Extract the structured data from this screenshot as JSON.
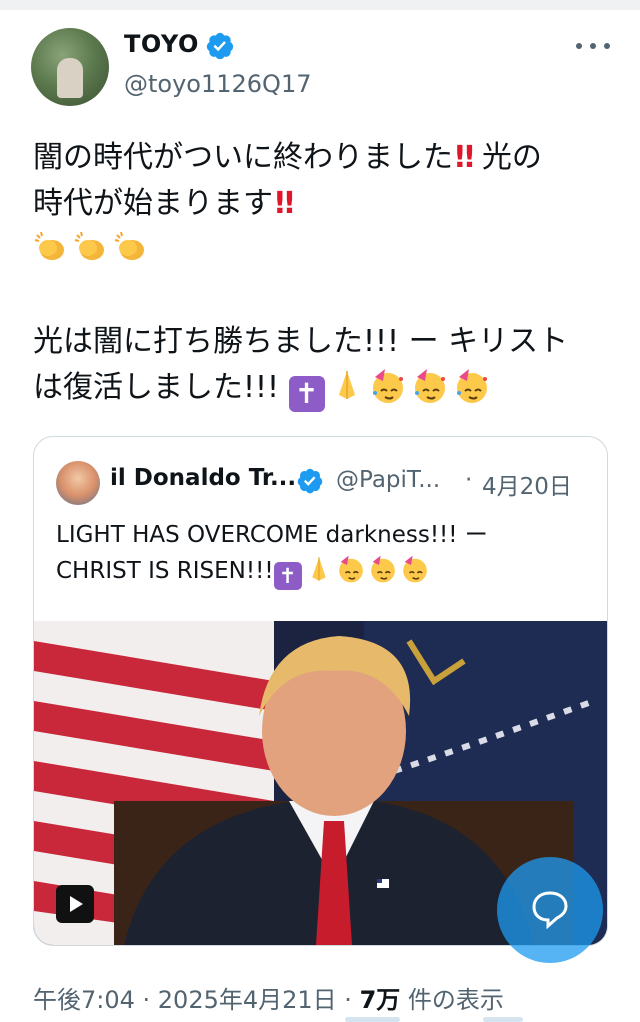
{
  "author": {
    "name": "TOYO",
    "handle": "@toyo1126Q17",
    "verified_icon": "verified-badge-icon",
    "more_icon": "more-icon"
  },
  "tweet": {
    "line1_a": "闇の時代がついに終わりました",
    "line1_b": "光の",
    "line2": "時代が始まります",
    "line3_a": "光は闇に打ち勝ちました!!! ー キリスト",
    "line3_b": "は復活しました!!!"
  },
  "quoted": {
    "name": "il Donaldo Tr...",
    "handle": "@PapiT...",
    "dot": "·",
    "date": "4月20日",
    "line1": "LIGHT HAS OVERCOME darkness!!! ー",
    "line2": "CHRIST IS RISEN!!!",
    "media_type": "video",
    "play_icon": "play-icon"
  },
  "meta": {
    "time_date": "午後7:04 · 2025年4月21日 · ",
    "views_count": "7万",
    "views_label": " 件の表示"
  },
  "colors": {
    "accent": "#1d9bf0",
    "text": "#0f1419",
    "secondary": "#536471",
    "border": "#cfd9de"
  }
}
